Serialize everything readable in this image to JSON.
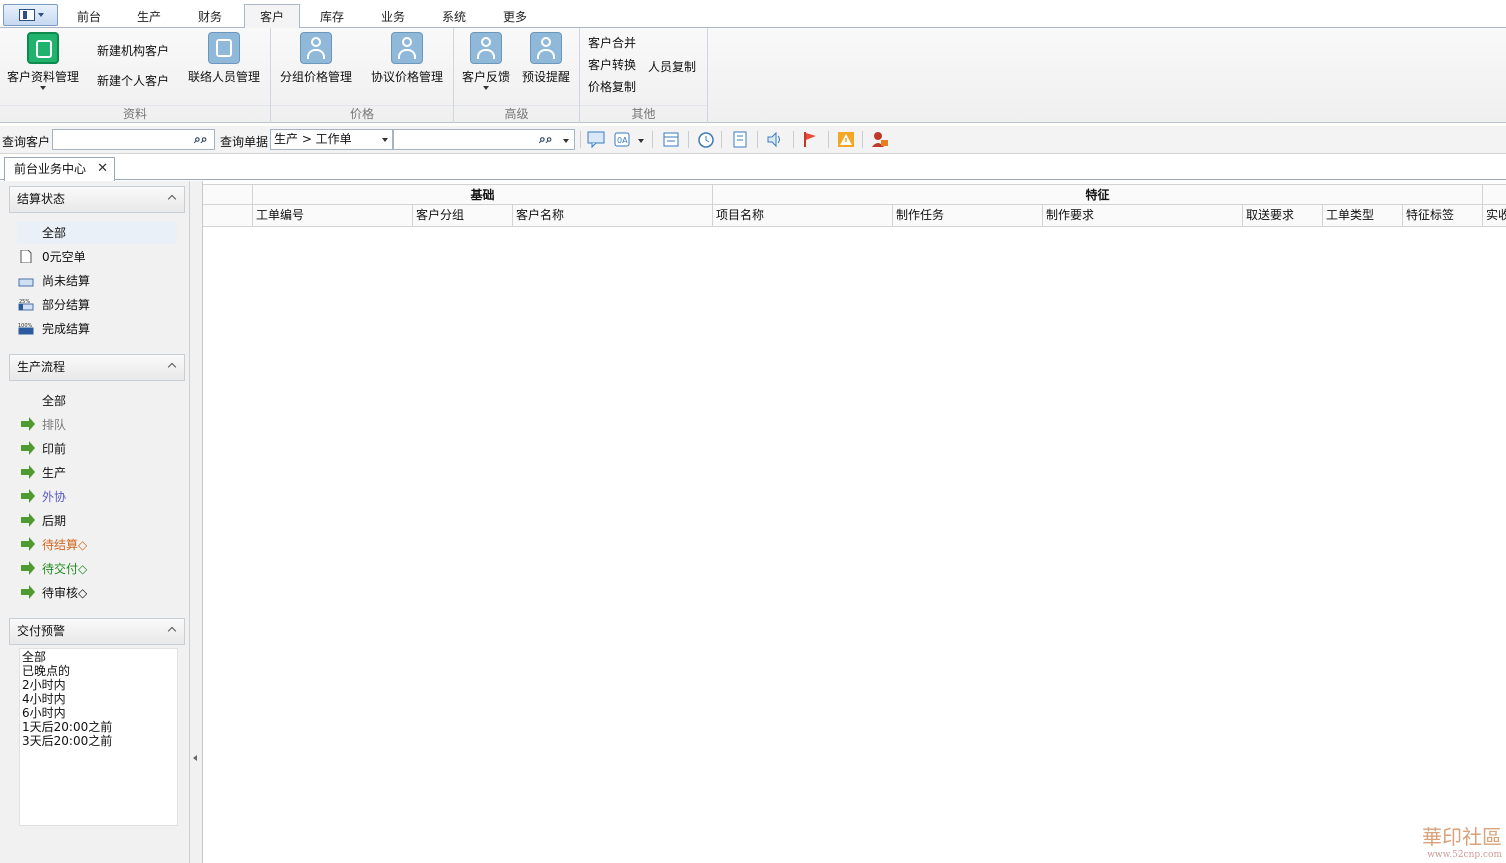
{
  "ribbon_tabs": [
    {
      "label": "前台",
      "active": false
    },
    {
      "label": "生产",
      "active": false
    },
    {
      "label": "财务",
      "active": false
    },
    {
      "label": "客户",
      "active": true
    },
    {
      "label": "库存",
      "active": false
    },
    {
      "label": "业务",
      "active": false
    },
    {
      "label": "系统",
      "active": false
    },
    {
      "label": "更多",
      "active": false
    }
  ],
  "ribbon": {
    "groups": {
      "info": {
        "label": "资料",
        "customer_info": "客户资料管理",
        "new_org": "新建机构客户",
        "new_person": "新建个人客户",
        "contacts": "联络人员管理"
      },
      "price": {
        "label": "价格",
        "group_price": "分组价格管理",
        "agreement_price": "协议价格管理"
      },
      "advanced": {
        "label": "高级",
        "feedback": "客户反馈",
        "reminder": "预设提醒"
      },
      "other": {
        "label": "其他",
        "merge": "客户合并",
        "convert": "客户转换",
        "copy_price": "价格复制",
        "copy_people": "人员复制"
      }
    }
  },
  "query": {
    "customer_label": "查询客户",
    "customer_value": "",
    "doc_label": "查询单据",
    "doc_type": "生产 > 工作单",
    "doc_value": ""
  },
  "doc_tab": {
    "label": "前台业务中心"
  },
  "left": {
    "settlement": {
      "title": "结算状态",
      "items": [
        "全部",
        "0元空单",
        "尚未结算",
        "部分结算",
        "完成结算"
      ]
    },
    "flow": {
      "title": "生产流程",
      "items": [
        {
          "label": "全部",
          "color": "#111111"
        },
        {
          "label": "排队",
          "color": "#7a7a7a"
        },
        {
          "label": "印前",
          "color": "#111111"
        },
        {
          "label": "生产",
          "color": "#111111"
        },
        {
          "label": "外协",
          "color": "#5b5bc8"
        },
        {
          "label": "后期",
          "color": "#111111"
        },
        {
          "label": "待结算◇",
          "color": "#d2691e"
        },
        {
          "label": "待交付◇",
          "color": "#1f8a1f"
        },
        {
          "label": "待审核◇",
          "color": "#111111"
        }
      ]
    },
    "warning": {
      "title": "交付预警",
      "items": [
        "全部",
        "已晚点的",
        "2小时内",
        "4小时内",
        "6小时内",
        "1天后20:00之前",
        "3天后20:00之前"
      ]
    }
  },
  "grid": {
    "groups": [
      "基础",
      "特征"
    ],
    "columns": [
      "工单编号",
      "客户分组",
      "客户名称",
      "项目名称",
      "制作任务",
      "制作要求",
      "取送要求",
      "工单类型",
      "特征标签",
      "实收"
    ]
  },
  "watermark": {
    "text": "華印社區",
    "sub": "www.52cnp.com"
  }
}
